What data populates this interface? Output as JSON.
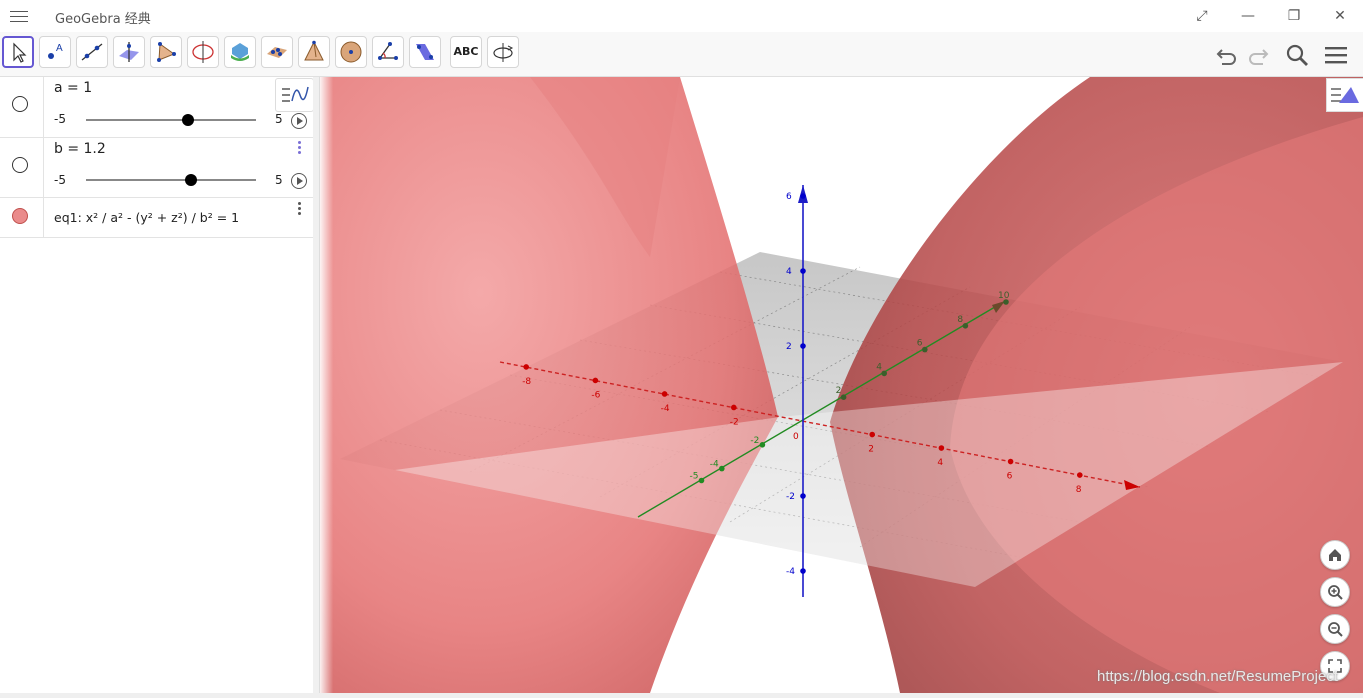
{
  "window": {
    "title": "GeoGebra 经典",
    "controls": {
      "expand_icon": "expand-icon",
      "minimize": "—",
      "restore": "❐",
      "close": "✕"
    }
  },
  "toolbar": {
    "tools": [
      {
        "name": "move-tool-icon",
        "active": true
      },
      {
        "name": "point-tool-icon"
      },
      {
        "name": "line-tool-icon"
      },
      {
        "name": "perpendicular-line-tool-icon"
      },
      {
        "name": "polygon-tool-icon"
      },
      {
        "name": "circle-axis-tool-icon"
      },
      {
        "name": "intersect-surfaces-tool-icon"
      },
      {
        "name": "plane-tool-icon"
      },
      {
        "name": "pyramid-tool-icon"
      },
      {
        "name": "sphere-tool-icon"
      },
      {
        "name": "angle-tool-icon"
      },
      {
        "name": "reflect-tool-icon"
      },
      {
        "name": "text-tool",
        "label": "ABC"
      },
      {
        "name": "rotate-view-tool-icon"
      }
    ],
    "right": [
      "undo-icon",
      "redo-icon",
      "search-icon",
      "main-menu-icon"
    ]
  },
  "algebra": {
    "items": [
      {
        "label": "a = 1",
        "min": "-5",
        "max": "5",
        "value": 1,
        "range": [
          -5,
          5
        ]
      },
      {
        "label": "b = 1.2",
        "min": "-5",
        "max": "5",
        "value": 1.2,
        "range": [
          -5,
          5
        ]
      },
      {
        "label": "eq1: x² / a² - (y² + z²) / b² = 1",
        "color": "#ea8b8b"
      }
    ]
  },
  "graphics": {
    "surface_color": "#e05a5a",
    "x_axis_color": "#cc0000",
    "y_axis_color": "#228b22",
    "z_axis_color": "#0000cc",
    "x_ticks": [
      "-8",
      "-6",
      "-4",
      "-2",
      "0",
      "2",
      "4",
      "6",
      "8"
    ],
    "y_ticks_neg": [
      "-5",
      "-4",
      "-2"
    ],
    "y_ticks_pos": [
      "2",
      "4",
      "6",
      "8",
      "10"
    ],
    "z_ticks": [
      "6",
      "4",
      "2",
      "-2",
      "-4"
    ],
    "origin_label": "0",
    "buttons": [
      "home-icon",
      "zoom-in-icon",
      "zoom-out-icon",
      "fullscreen-icon"
    ]
  },
  "watermark": "https://blog.csdn.net/ResumeProject"
}
